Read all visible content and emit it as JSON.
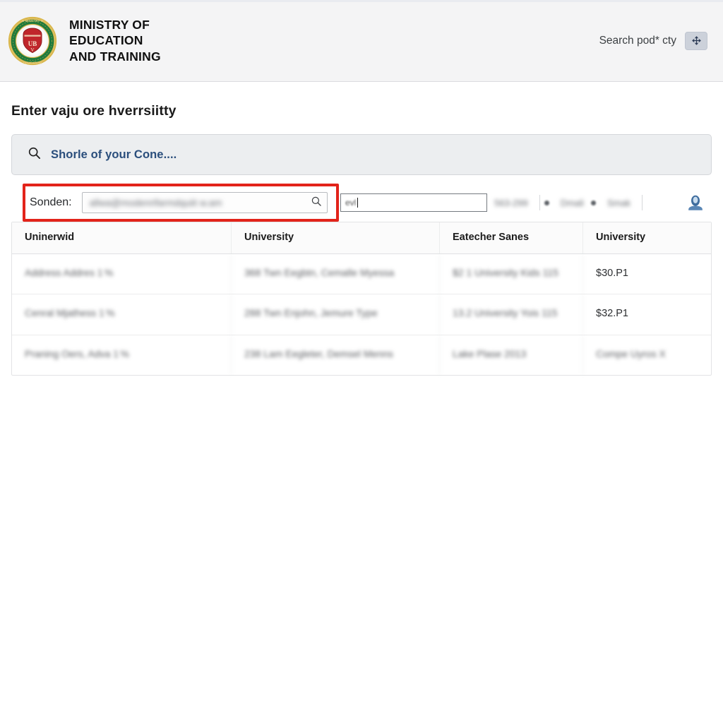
{
  "banner": {
    "seal_alt": "ministry-seal",
    "ministry_name": "MINISTRY OF\nEDUCATION\nAND TRAINING",
    "search_label": "Search pod* cty",
    "search_button_icon": "move-crosshair-icon"
  },
  "page": {
    "title": "Enter vaju ore hverrsiitty"
  },
  "search": {
    "icon": "search-icon",
    "text": "Shorle of your Cone...."
  },
  "toolbar": {
    "sender_label": "Sonden:",
    "sender_value": "allwa@modenrifarmdquiit w.am",
    "sender_icon": "search-icon",
    "mini_input_value": "evl",
    "chunk_one": "563-299",
    "item_one": "Dmali",
    "item_two": "Smak",
    "avatar_icon": "user-avatar-icon"
  },
  "table": {
    "columns": [
      "Uninerwid",
      "University",
      "Eatecher Sanes",
      "University"
    ],
    "rows": [
      {
        "cells": [
          "Address Addres 1 %",
          "368 Twn Eegbtn, Cemalle\nMyessa",
          "$2 1 University\nKids 115",
          "$30.P1"
        ],
        "blurred": [
          true,
          true,
          true,
          false
        ]
      },
      {
        "cells": [
          "Cenral Mjathess 1 %",
          "288 Twn Enjohn, Jemure\nType",
          "13.2 University\nYois 115",
          "$32.P1"
        ],
        "blurred": [
          true,
          true,
          true,
          false
        ]
      },
      {
        "cells": [
          "Praning Oers, Adva 1 %",
          "238 Lam Eegleter, Demsel\nMenns",
          "Lake Plase\n2013",
          "Compe Uyros X"
        ],
        "blurred": [
          true,
          true,
          true,
          true
        ]
      }
    ]
  },
  "colors": {
    "accent_red": "#e2231a",
    "link_blue": "#2a4e7c",
    "banner_bg": "#f4f4f5",
    "seal_green": "#1f7a3d",
    "seal_gold": "#d9b64a",
    "seal_red": "#c0262b",
    "avatar_blue": "#5a86b5"
  }
}
